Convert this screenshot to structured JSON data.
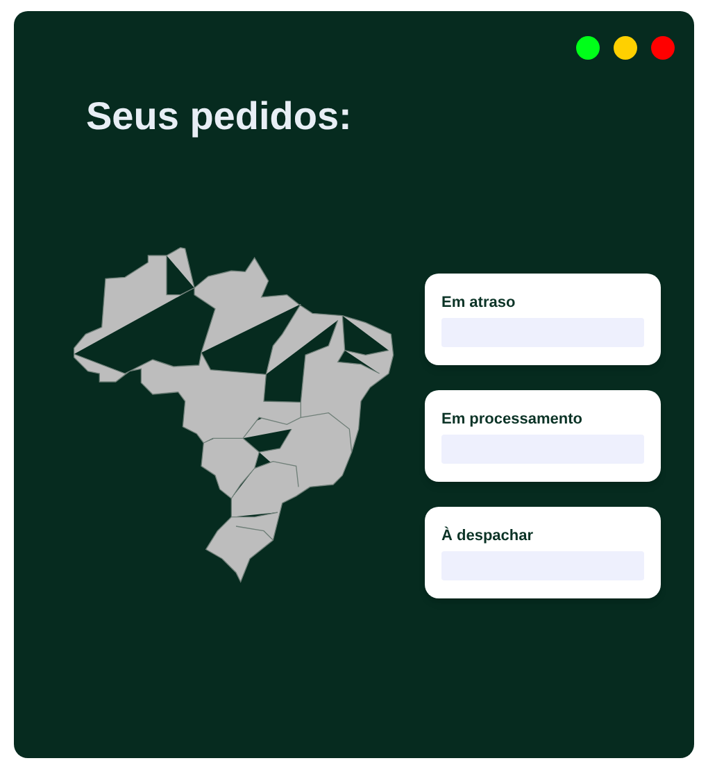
{
  "window": {
    "controls": [
      {
        "color": "#00ff19"
      },
      {
        "color": "#ffd000"
      },
      {
        "color": "#ff0000"
      }
    ]
  },
  "title": "Seus pedidos:",
  "order_cards": [
    {
      "label": "Em atraso"
    },
    {
      "label": "Em processamento"
    },
    {
      "label": "À despachar"
    }
  ]
}
